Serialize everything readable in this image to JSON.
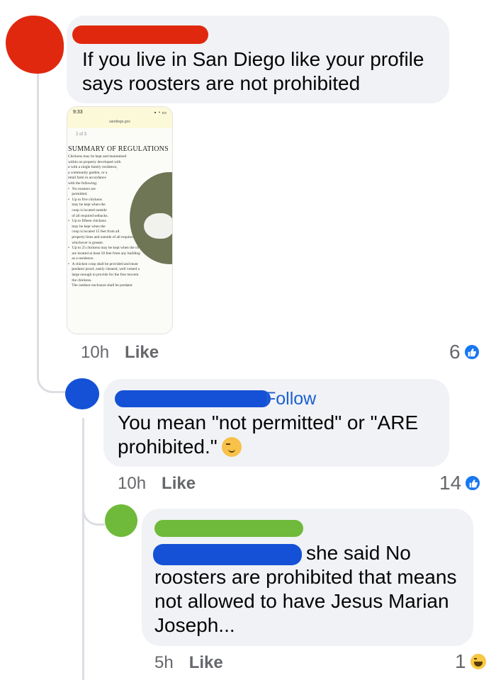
{
  "comments": [
    {
      "text": "If you live in San Diego like your profile says roosters are not prohibited",
      "time": "10h",
      "like_label": "Like",
      "reaction_count": "6",
      "avatar_color": "#e0280f",
      "attachment": {
        "status_time": "9:33",
        "url": "sandiego.gov",
        "page_indicator": "2 of 3",
        "heading": "SUMMARY OF REGULATIONS",
        "body": "Chickens may be kept and maintained\nwithin on property developed with\na with a single family residence,\na community garden, or a\nretail farm in accordance\nwith the following:\n•   No roosters are\n    permitted.\n•   Up to five chickens\n    may be kept when the\n    coop is located outside\n    of all required setbacks.\n•   Up to fifteen chickens\n    may be kept when the\n    coop is located 15 feet from all\n    property lines and outside of all required set\n    whichever is greater.\n•   Up to 25 chickens may be kept when the ch\n    are located at least 50 feet from any building\n    as a residence.\n•   A chicken coop shall be provided and must\n    predator proof, easily cleaned, well vented a\n    large enough to provide for the free movem\n    the chickens.\n    The outdoor enclosure shall be predator"
      }
    },
    {
      "follow_label": "Follow",
      "text": "You mean \"not permitted\" or \"ARE prohibited.\"",
      "time": "10h",
      "like_label": "Like",
      "reaction_count": "14",
      "avatar_color": "#1451d6"
    },
    {
      "text": "she said No roosters are prohibited  that means not allowed to have Jesus Marian Joseph...",
      "time": "5h",
      "like_label": "Like",
      "reaction_count": "1",
      "avatar_color": "#6fba3a"
    }
  ],
  "colors": {
    "redact_red": "#e0280f",
    "redact_blue": "#1451d6",
    "redact_green": "#6fba3a",
    "link_blue": "#1c5fd1",
    "bubble_bg": "#f0f2f5"
  }
}
